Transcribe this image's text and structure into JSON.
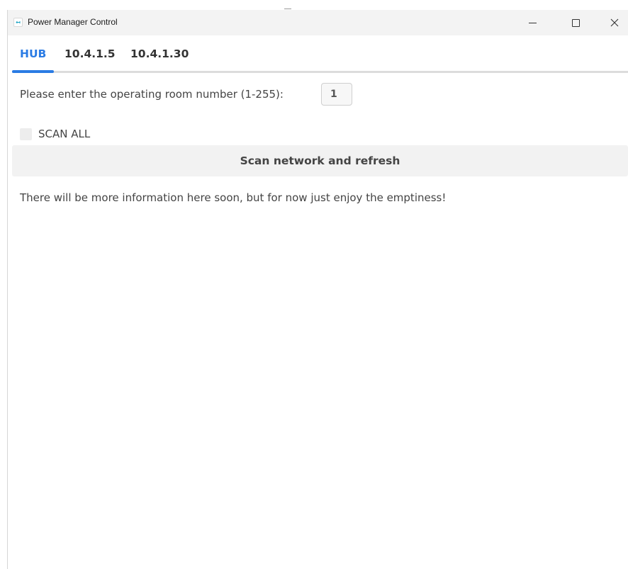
{
  "window": {
    "title": "Power Manager Control",
    "app_icon": "power-manager-icon"
  },
  "titlebar_controls": {
    "minimize": "minimize-icon",
    "maximize": "maximize-icon",
    "close": "close-icon"
  },
  "tabs": [
    {
      "label": "HUB",
      "active": true
    },
    {
      "label": "10.4.1.5",
      "active": false
    },
    {
      "label": "10.4.1.30",
      "active": false
    }
  ],
  "room": {
    "label": "Please enter the operating room number (1-255):",
    "value": "1"
  },
  "scan_all": {
    "label": "SCAN ALL",
    "checked": false
  },
  "refresh_button": {
    "label": "Scan network and refresh"
  },
  "info": {
    "text": "There will be more information here soon, but for now just enjoy the emptiness!"
  },
  "colors": {
    "accent": "#2a7be4",
    "titlebar": "#f3f3f3",
    "button_bg": "#f2f2f2",
    "text": "#444444"
  }
}
